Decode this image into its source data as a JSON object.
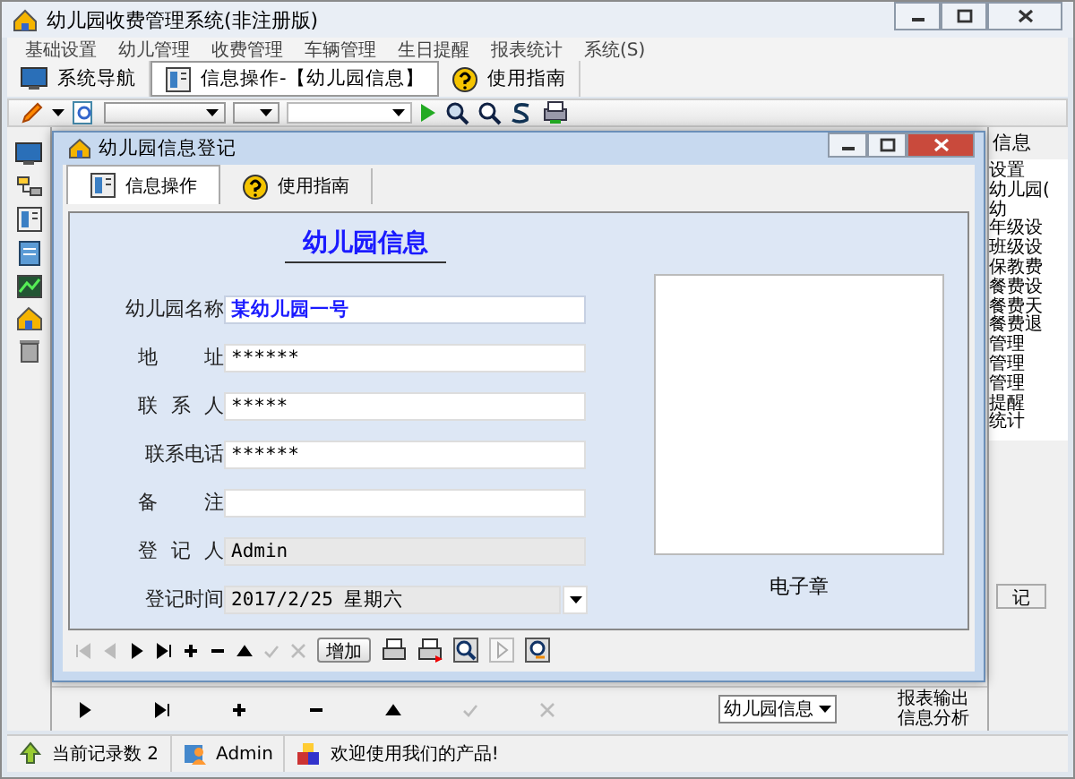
{
  "window": {
    "title": "幼儿园收费管理系统(非注册版)"
  },
  "menu": [
    "基础设置",
    "幼儿管理",
    "收费管理",
    "车辆管理",
    "生日提醒",
    "报表统计",
    "系统(S)"
  ],
  "nav_tabs": [
    {
      "label": "系统导航",
      "kind": "monitor",
      "selected": false
    },
    {
      "label": "信息操作-【幼儿园信息】",
      "kind": "form",
      "selected": true
    },
    {
      "label": "使用指南",
      "kind": "help",
      "selected": false
    }
  ],
  "tree": {
    "header": "信息",
    "items": [
      "设置",
      "幼儿园(",
      "幼",
      "年级设",
      "班级设",
      "保教费",
      "餐费设",
      "餐费天",
      "餐费退",
      "管理",
      "管理",
      "管理",
      "提醒",
      "统计"
    ]
  },
  "side_button": "记",
  "bottom_bar": {
    "dropdown": "幼儿园信息",
    "links": [
      "报表输出",
      "信息分析"
    ]
  },
  "dialog": {
    "title": "幼儿园信息登记",
    "tabs": [
      {
        "label": "信息操作",
        "kind": "form",
        "selected": true
      },
      {
        "label": "使用指南",
        "kind": "help",
        "selected": false
      }
    ],
    "form_title": "幼儿园信息",
    "fields": [
      {
        "label": "幼儿园名称",
        "value": "某幼儿园一号",
        "kind": "text",
        "highlighted": true,
        "disabled": false
      },
      {
        "label": "地址",
        "value": "******",
        "kind": "text",
        "highlighted": false,
        "disabled": false
      },
      {
        "label": "联系人",
        "value": "*****",
        "kind": "text",
        "highlighted": false,
        "disabled": false
      },
      {
        "label": "联系电话",
        "value": "******",
        "kind": "text",
        "highlighted": false,
        "disabled": false
      },
      {
        "label": "备注",
        "kind": "text",
        "highlighted": false,
        "disabled": false
      },
      {
        "label": "登记人",
        "value": "Admin",
        "kind": "text",
        "highlighted": false,
        "disabled": true
      },
      {
        "label": "登记时间",
        "value": "2017/2/25 星期六",
        "kind": "date",
        "highlighted": false,
        "disabled": true
      }
    ],
    "stamp_label": "电子章",
    "add_button": "增加"
  },
  "status_bar": [
    {
      "text": "当前记录数 2",
      "kind": "records"
    },
    {
      "text": "Admin",
      "kind": "user"
    },
    {
      "text": "欢迎使用我们的产品!",
      "kind": "welcome"
    }
  ]
}
